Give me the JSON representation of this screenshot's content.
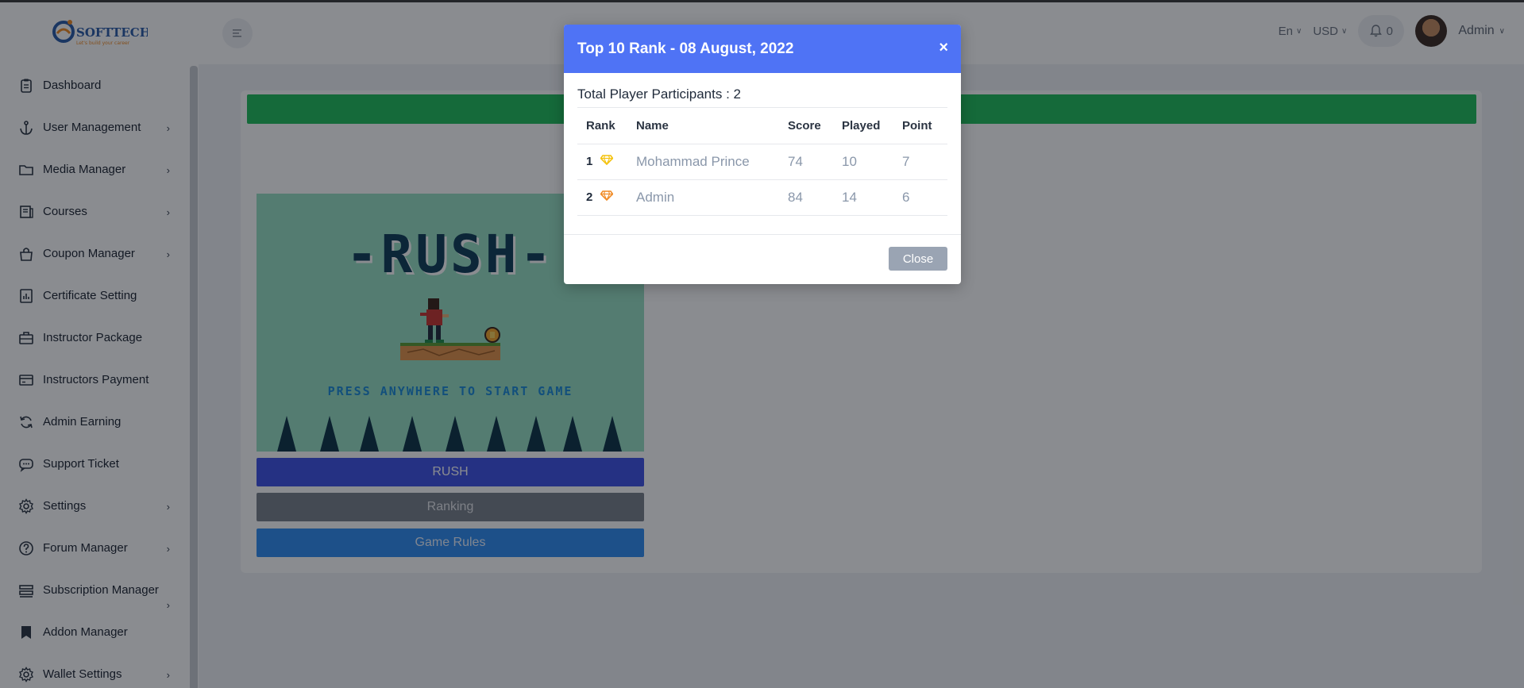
{
  "sidebar": {
    "logo_text": "SOFTTECH-IT",
    "logo_tagline": "Let's build your career",
    "items": [
      {
        "label": "Dashboard",
        "icon": "clipboard-icon",
        "has_submenu": false
      },
      {
        "label": "User Management",
        "icon": "anchor-icon",
        "has_submenu": true
      },
      {
        "label": "Media Manager",
        "icon": "folder-icon",
        "has_submenu": true
      },
      {
        "label": "Courses",
        "icon": "courses-icon",
        "has_submenu": true
      },
      {
        "label": "Coupon Manager",
        "icon": "bag-icon",
        "has_submenu": true
      },
      {
        "label": "Certificate Setting",
        "icon": "chart-icon",
        "has_submenu": false
      },
      {
        "label": "Instructor Package",
        "icon": "briefcase-icon",
        "has_submenu": false
      },
      {
        "label": "Instructors Payment",
        "icon": "card-icon",
        "has_submenu": false
      },
      {
        "label": "Admin Earning",
        "icon": "refresh-icon",
        "has_submenu": false
      },
      {
        "label": "Support Ticket",
        "icon": "chat-icon",
        "has_submenu": false
      },
      {
        "label": "Settings",
        "icon": "gear-icon",
        "has_submenu": true
      },
      {
        "label": "Forum Manager",
        "icon": "question-icon",
        "has_submenu": true
      },
      {
        "label": "Subscription Manager",
        "icon": "list-icon",
        "has_submenu": true
      },
      {
        "label": "Addon Manager",
        "icon": "bookmark-icon",
        "has_submenu": false
      },
      {
        "label": "Wallet Settings",
        "icon": "gear-icon",
        "has_submenu": true
      }
    ]
  },
  "header": {
    "language": "En",
    "currency": "USD",
    "notification_count": "0",
    "user_name": "Admin"
  },
  "game": {
    "title": "-RUSH-",
    "press_text": "PRESS ANYWHERE TO START GAME",
    "buttons": {
      "rush": "RUSH",
      "ranking": "Ranking",
      "rules": "Game Rules"
    }
  },
  "modal": {
    "title": "Top 10 Rank - 08 August, 2022",
    "close_x": "×",
    "participants": "Total Player Participants : 2",
    "columns": [
      "Rank",
      "Name",
      "Score",
      "Played",
      "Point"
    ],
    "rows": [
      {
        "rank": "1",
        "name": "Mohammad Prince",
        "score": "74",
        "played": "10",
        "point": "7",
        "gem_color": "#f4c20d"
      },
      {
        "rank": "2",
        "name": "Admin",
        "score": "84",
        "played": "14",
        "point": "6",
        "gem_color": "#f08a24"
      }
    ],
    "close_button": "Close"
  },
  "colors": {
    "modal_header": "#4f73f5",
    "green_bar": "#1fbf5b",
    "rush_button": "#3f51e6",
    "rules_button": "#2f8cf1"
  }
}
